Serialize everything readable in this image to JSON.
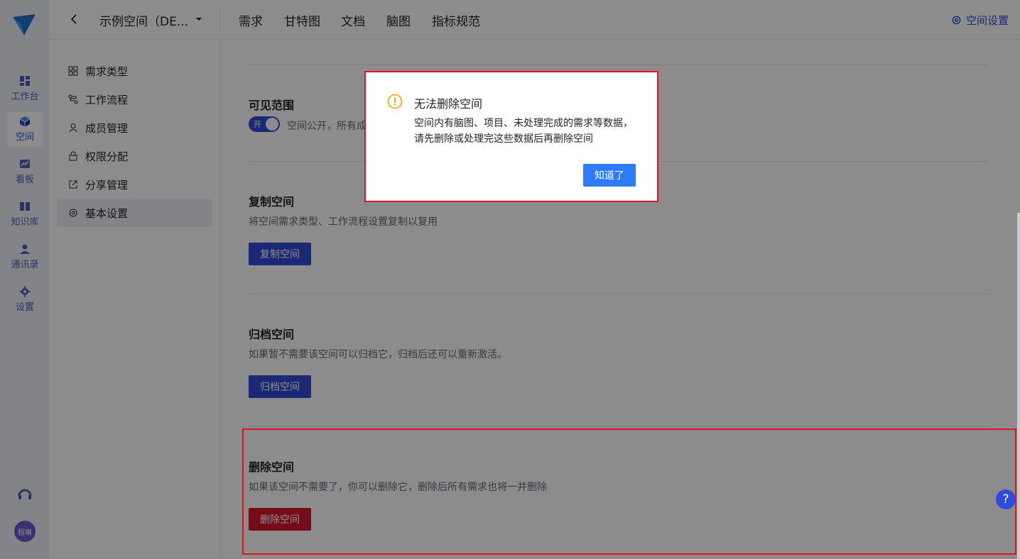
{
  "rail": {
    "items": [
      {
        "label": "工作台",
        "icon": "dashboard-icon"
      },
      {
        "label": "空间",
        "icon": "cube-icon"
      },
      {
        "label": "看板",
        "icon": "chart-icon"
      },
      {
        "label": "知识库",
        "icon": "book-icon"
      },
      {
        "label": "通讯录",
        "icon": "contacts-icon"
      },
      {
        "label": "设置",
        "icon": "gear-icon"
      }
    ],
    "avatar_text": "程琳"
  },
  "topbar": {
    "space_title": "示例空间（DE...",
    "tabs": [
      "需求",
      "甘特图",
      "文档",
      "脑图",
      "指标规范"
    ],
    "settings_label": "空间设置"
  },
  "menu": {
    "items": [
      {
        "label": "需求类型",
        "icon": "grid-icon"
      },
      {
        "label": "工作流程",
        "icon": "flow-icon"
      },
      {
        "label": "成员管理",
        "icon": "user-icon"
      },
      {
        "label": "权限分配",
        "icon": "lock-icon"
      },
      {
        "label": "分享管理",
        "icon": "share-icon"
      },
      {
        "label": "基本设置",
        "icon": "gear-icon"
      }
    ],
    "active_index": 5
  },
  "main": {
    "visibility": {
      "title": "可见范围",
      "toggle_label": "开",
      "toggle_on": true,
      "desc": "空间公开，所有成"
    },
    "copy": {
      "title": "复制空间",
      "desc": "将空间需求类型、工作流程设置复制以复用",
      "button": "复制空间"
    },
    "archive": {
      "title": "归档空间",
      "desc": "如果暂不需要该空间可以归档它，归档后还可以重新激活。",
      "button": "归档空间"
    },
    "delete": {
      "title": "删除空间",
      "desc": "如果该空间不需要了，你可以删除它，删除后所有需求也将一并删除",
      "button": "删除空间"
    }
  },
  "modal": {
    "title": "无法删除空间",
    "body_line1": "空间内有脑图、项目、未处理完成的需求等数据，",
    "body_line2": "请先删除或处理完这些数据后再删除空间",
    "ok": "知道了"
  },
  "help": {
    "label": "?"
  },
  "colors": {
    "primary": "#2f4bd8",
    "danger": "#d5172b",
    "modal_ok": "#2f7bff",
    "warning": "#f5a623",
    "highlight": "#e0161b"
  }
}
